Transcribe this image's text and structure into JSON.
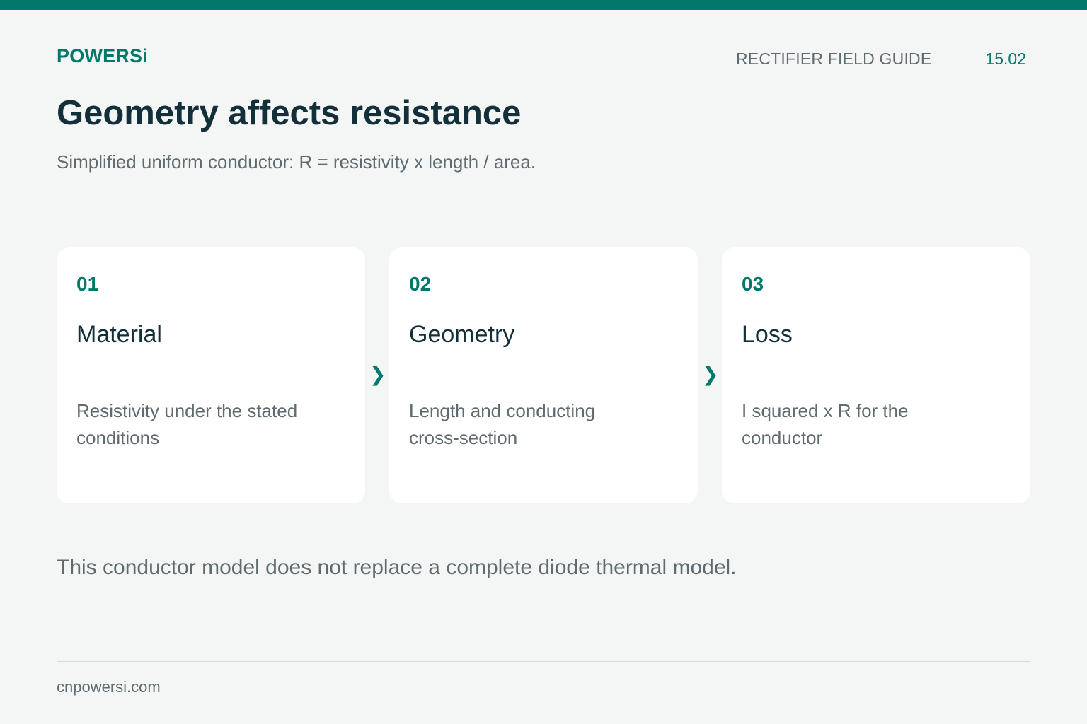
{
  "header": {
    "brand": "POWERSi",
    "guide_label": "RECTIFIER FIELD GUIDE",
    "guide_number": "15.02"
  },
  "title": "Geometry affects resistance",
  "subtitle": "Simplified uniform conductor: R = resistivity x length / area.",
  "cards": [
    {
      "number": "01",
      "title": "Material",
      "description": "Resistivity under the stated conditions"
    },
    {
      "number": "02",
      "title": "Geometry",
      "description": "Length and conducting cross-section"
    },
    {
      "number": "03",
      "title": "Loss",
      "description": "I squared x R for the conductor"
    }
  ],
  "arrow_glyph": "❯",
  "note": "This conductor model does not replace a complete diode thermal model.",
  "footer": {
    "url": "cnpowersi.com"
  },
  "colors": {
    "accent": "#00796b",
    "background": "#f4f6f5",
    "card": "#ffffff",
    "heading": "#13303a",
    "muted": "#5f6b70"
  }
}
